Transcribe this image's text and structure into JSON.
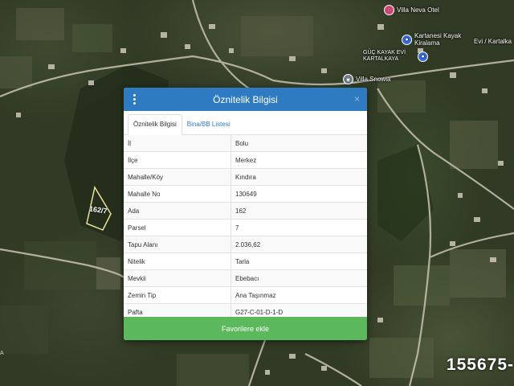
{
  "map": {
    "pois": [
      {
        "name": "Villa Neva Otel",
        "icon": "hotel-icon"
      },
      {
        "name": "Kartanesi Kayak Kiralama",
        "icon": "shop-icon"
      },
      {
        "name": "Evi / Kartalka",
        "icon": "place-icon"
      },
      {
        "name": "GÜÇ KAYAK EVİ KARTALKAYA",
        "icon": "shop-icon"
      },
      {
        "name": "Villa Snowia",
        "icon": "place-icon"
      }
    ],
    "parcel_label": "162/7",
    "watermark": "155675-",
    "corner_mark": "A"
  },
  "modal": {
    "title": "Öznitelik Bilgisi",
    "close_symbol": "×",
    "tabs": [
      {
        "label": "Öznitelik Bilgisi",
        "active": true
      },
      {
        "label": "Bina/BB Listesi",
        "active": false
      }
    ],
    "rows": [
      {
        "key": "İl",
        "value": "Bolu"
      },
      {
        "key": "İlçe",
        "value": "Merkez"
      },
      {
        "key": "Mahalle/Köy",
        "value": "Kındıra"
      },
      {
        "key": "Mahalle No",
        "value": "130649"
      },
      {
        "key": "Ada",
        "value": "162"
      },
      {
        "key": "Parsel",
        "value": "7"
      },
      {
        "key": "Tapu Alanı",
        "value": "2.036,62"
      },
      {
        "key": "Nitelik",
        "value": "Tarla"
      },
      {
        "key": "Mevkii",
        "value": "Ebebacı"
      },
      {
        "key": "Zemin Tip",
        "value": "Ana Taşınmaz"
      },
      {
        "key": "Pafta",
        "value": "G27-C-01-D-1-D"
      }
    ],
    "favorite_button": "Favorilere ekle"
  },
  "colors": {
    "header": "#2f7bc1",
    "button": "#5cb85c",
    "parcel_outline": "#e8e29a"
  }
}
